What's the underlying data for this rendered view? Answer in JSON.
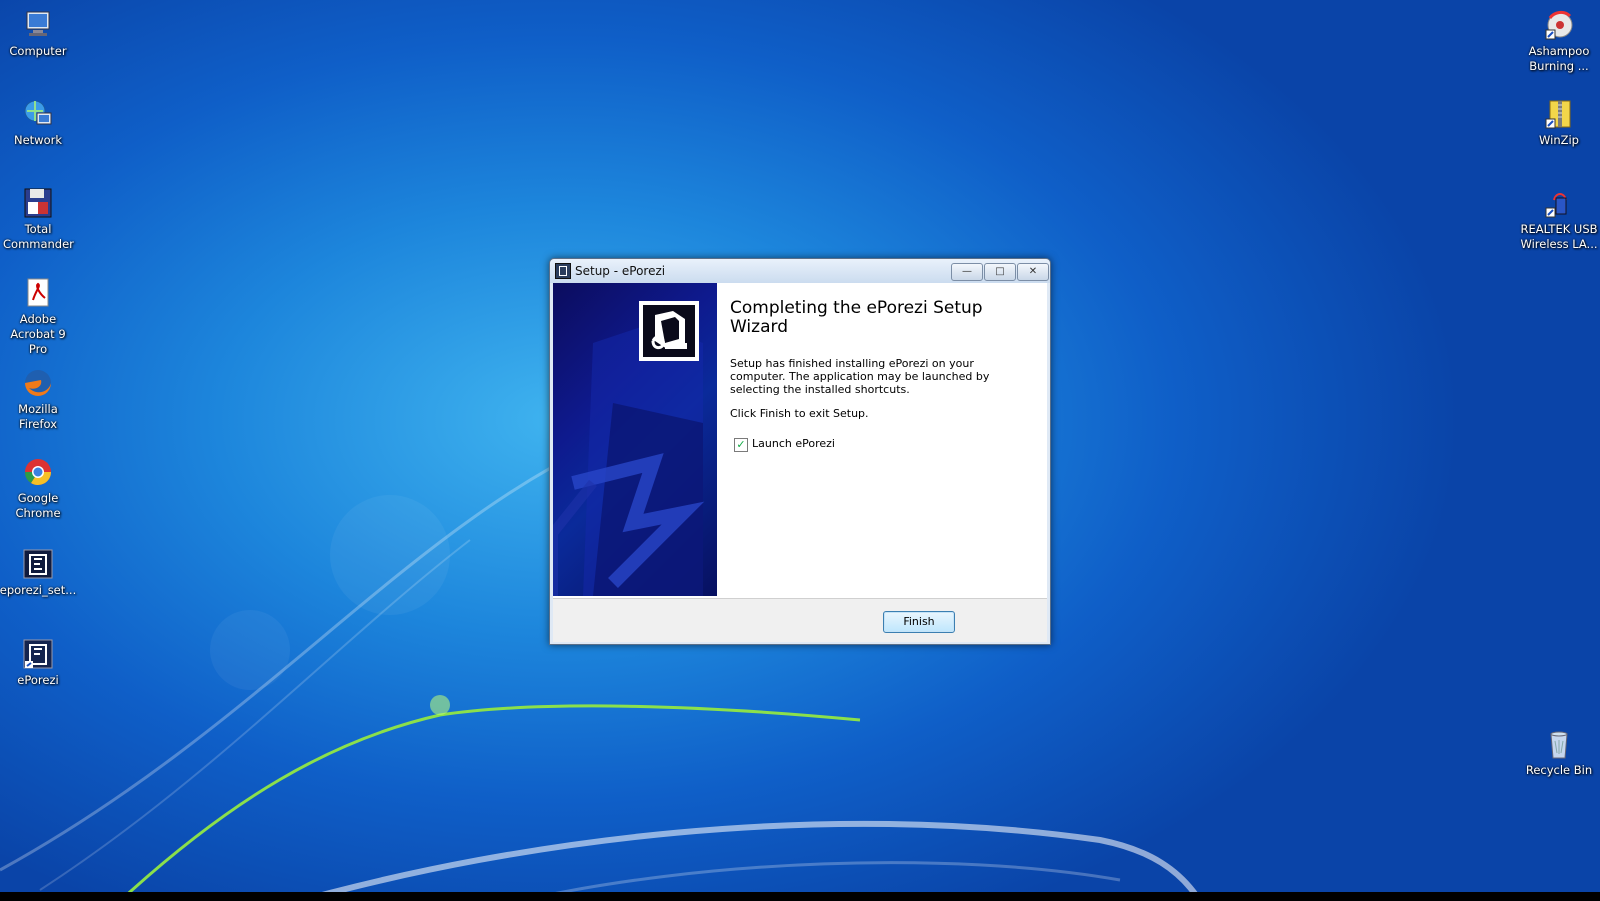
{
  "desktop": {
    "left_icons": [
      {
        "label": "Computer",
        "icon": "computer-icon"
      },
      {
        "label": "Network",
        "icon": "network-icon"
      },
      {
        "label": "Total Commander",
        "icon": "total-commander-icon"
      },
      {
        "label": "Adobe Acrobat 9 Pro",
        "icon": "adobe-acrobat-icon"
      },
      {
        "label": "Mozilla Firefox",
        "icon": "firefox-icon"
      },
      {
        "label": "Google Chrome",
        "icon": "chrome-icon"
      },
      {
        "label": "eporezi_set...",
        "icon": "eporezi-setup-icon"
      },
      {
        "label": "ePorezi",
        "icon": "eporezi-icon"
      }
    ],
    "right_icons": [
      {
        "label": "Ashampoo Burning ...",
        "icon": "ashampoo-icon"
      },
      {
        "label": "WinZip",
        "icon": "winzip-icon"
      },
      {
        "label": "REALTEK USB Wireless LA...",
        "icon": "realtek-icon"
      },
      {
        "label": "Recycle Bin",
        "icon": "recycle-bin-icon"
      }
    ]
  },
  "dialog": {
    "title": "Setup - ePorezi",
    "minimize_glyph": "—",
    "maximize_glyph": "□",
    "close_glyph": "✕",
    "heading": "Completing the ePorezi Setup Wizard",
    "body_text": "Setup has finished installing ePorezi on your computer. The application may be launched by selecting the installed shortcuts.",
    "exit_text": "Click Finish to exit Setup.",
    "launch_checkbox": {
      "label": "Launch ePorezi",
      "checked": true,
      "mark": "✓"
    },
    "finish_button": "Finish"
  }
}
